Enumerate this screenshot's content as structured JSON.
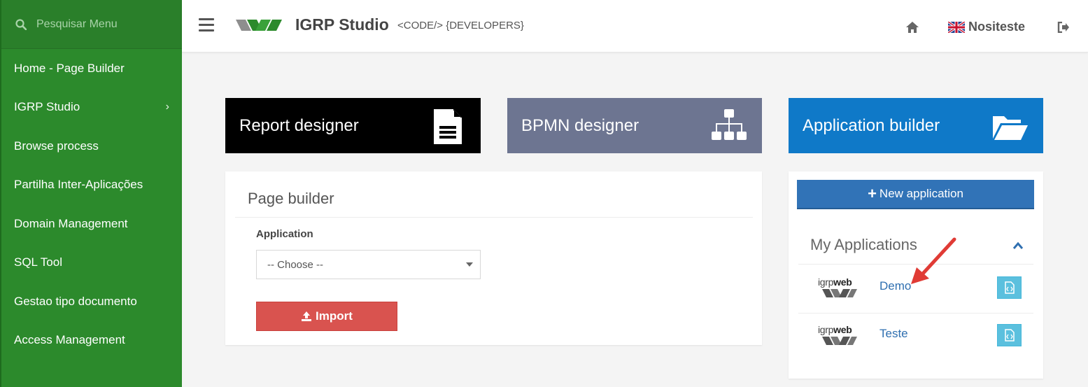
{
  "sidebar": {
    "search_placeholder": "Pesquisar Menu",
    "items": [
      {
        "label": "Home - Page Builder"
      },
      {
        "label": "IGRP Studio",
        "chevron": "›"
      },
      {
        "label": "Browse process"
      },
      {
        "label": "Partilha Inter-Aplicações"
      },
      {
        "label": "Domain Management"
      },
      {
        "label": "SQL Tool"
      },
      {
        "label": "Gestao tipo documento"
      },
      {
        "label": "Access Management"
      }
    ]
  },
  "header": {
    "title": "IGRP Studio",
    "subtitle": "<CODE/> {DEVELOPERS}",
    "user": "Nositeste"
  },
  "tiles": {
    "report": {
      "label": "Report designer",
      "icon": "document-icon"
    },
    "bpmn": {
      "label": "BPMN designer",
      "icon": "sitemap-icon"
    },
    "app": {
      "label": "Application builder",
      "icon": "folder-open-icon"
    }
  },
  "page_builder": {
    "title": "Page builder",
    "application_label": "Application",
    "select_value": "-- Choose --",
    "import_label": "Import"
  },
  "applications": {
    "new_button": "New application",
    "title": "My Applications",
    "logo_text_light": "igrp",
    "logo_text_bold": "web",
    "list": [
      {
        "name": "Demo"
      },
      {
        "name": "Teste"
      }
    ]
  },
  "colors": {
    "sidebar": "#2c8a2c",
    "report_tile": "#000000",
    "bpmn_tile": "#6d7591",
    "app_tile": "#0f79c8",
    "new_app_button": "#3173b7",
    "import_button": "#d9534f",
    "annotation_arrow": "#e03b35"
  }
}
